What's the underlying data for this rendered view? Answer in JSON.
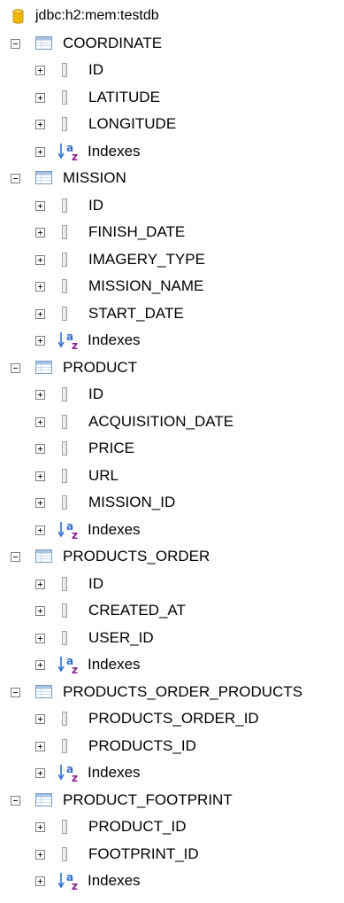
{
  "root": {
    "label": "jdbc:h2:mem:testdb",
    "icon": "database-icon"
  },
  "tables": [
    {
      "name": "COORDINATE",
      "columns": [
        "ID",
        "LATITUDE",
        "LONGITUDE"
      ],
      "indexes_label": "Indexes"
    },
    {
      "name": "MISSION",
      "columns": [
        "ID",
        "FINISH_DATE",
        "IMAGERY_TYPE",
        "MISSION_NAME",
        "START_DATE"
      ],
      "indexes_label": "Indexes"
    },
    {
      "name": "PRODUCT",
      "columns": [
        "ID",
        "ACQUISITION_DATE",
        "PRICE",
        "URL",
        "MISSION_ID"
      ],
      "indexes_label": "Indexes"
    },
    {
      "name": "PRODUCTS_ORDER",
      "columns": [
        "ID",
        "CREATED_AT",
        "USER_ID"
      ],
      "indexes_label": "Indexes"
    },
    {
      "name": "PRODUCTS_ORDER_PRODUCTS",
      "columns": [
        "PRODUCTS_ORDER_ID",
        "PRODUCTS_ID"
      ],
      "indexes_label": "Indexes"
    },
    {
      "name": "PRODUCT_FOOTPRINT",
      "columns": [
        "PRODUCT_ID",
        "FOOTPRINT_ID"
      ],
      "indexes_label": "Indexes"
    }
  ],
  "colors": {
    "database_icon": "#f5b800",
    "table_icon_border": "#7a9cc6",
    "table_icon_header": "#a8c4e4",
    "column_icon": "#b7b7b7",
    "index_arrow": "#2f6fd0",
    "index_letter_a": "#2f6fd0",
    "index_letter_z": "#8b1e8f"
  }
}
